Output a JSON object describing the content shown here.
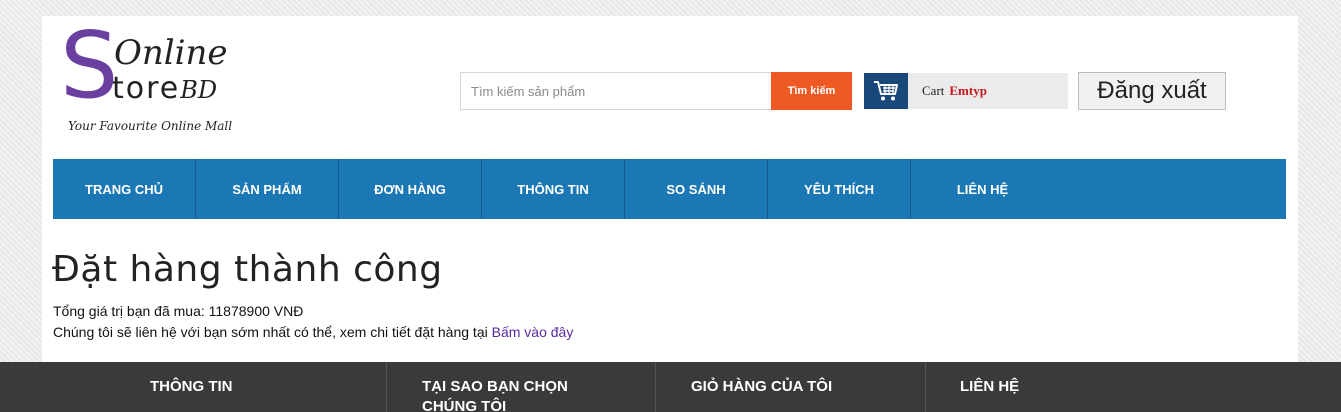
{
  "logo": {
    "big_letter": "S",
    "line1": "Online",
    "line2_main": "tore",
    "line2_suffix": "BD",
    "tagline": "Your Favourite Online Mall"
  },
  "search": {
    "placeholder": "Tìm kiếm sản phẩm",
    "value": "",
    "button_label": "Tìm kiếm"
  },
  "cart": {
    "icon": "cart-icon",
    "label": "Cart",
    "state": "Emtyp"
  },
  "logout_label": "Đăng xuất",
  "nav": {
    "items": [
      {
        "label": "TRANG CHỦ"
      },
      {
        "label": "SẢN PHẨM"
      },
      {
        "label": "ĐƠN HÀNG"
      },
      {
        "label": "THÔNG TIN"
      },
      {
        "label": "SO SÁNH"
      },
      {
        "label": "YÊU THÍCH"
      },
      {
        "label": "LIÊN HỆ"
      }
    ]
  },
  "main": {
    "title": "Đặt hàng thành công",
    "total_text": "Tổng giá trị bạn đã mua: 11878900 VNĐ",
    "contact_text": "Chúng tôi sẽ liên hệ với bạn sớm nhất có thể, xem chi tiết đặt hàng tại",
    "link_label": "Bấm vào đây"
  },
  "footer": {
    "columns": [
      {
        "label": "THÔNG TIN"
      },
      {
        "label": "TẠI SAO BẠN CHỌN CHÚNG TÔI"
      },
      {
        "label": "GIỎ HÀNG CỦA TÔI"
      },
      {
        "label": "LIÊN HỆ"
      }
    ]
  },
  "colors": {
    "nav_bg": "#1b78b5",
    "search_button": "#ef5a24",
    "cart_icon_bg": "#18487a",
    "cart_state": "#c3181e",
    "logo_s": "#6b3fa0",
    "link": "#5b2aa0",
    "footer_bg": "#3a3a3a"
  }
}
